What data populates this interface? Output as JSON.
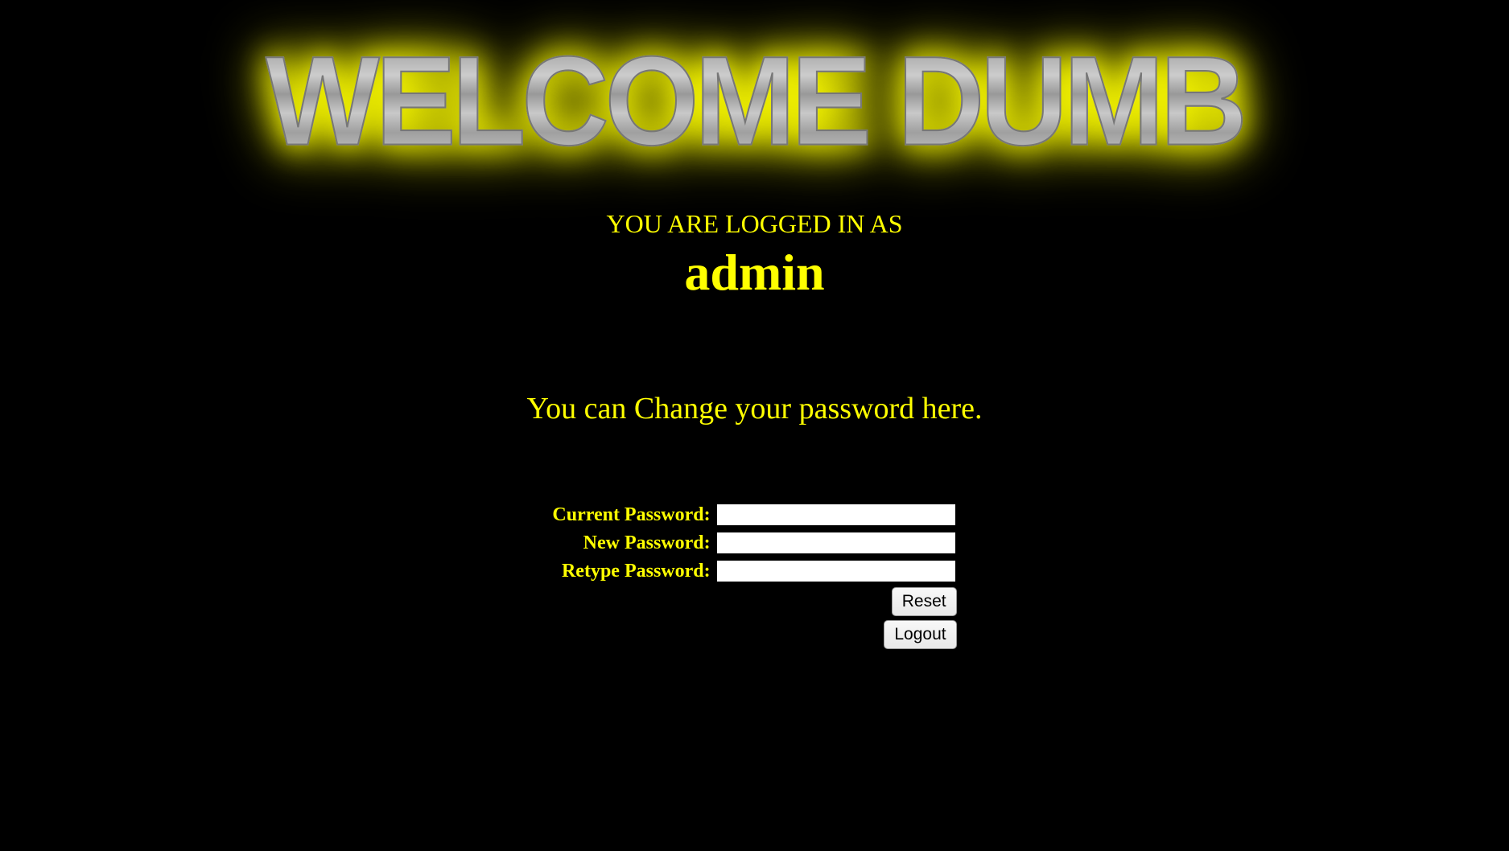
{
  "banner": {
    "text": "WELCOME DUMB"
  },
  "status": {
    "logged_in_label": "YOU ARE LOGGED IN AS",
    "username": "admin"
  },
  "form": {
    "title": "You can Change your password here.",
    "fields": {
      "current_password_label": "Current Password:",
      "new_password_label": "New Password:",
      "retype_password_label": "Retype Password:"
    },
    "buttons": {
      "reset": "Reset",
      "logout": "Logout"
    }
  },
  "colors": {
    "background": "#000000",
    "text_accent": "#FFFF00",
    "glow": "#FFFF00"
  }
}
